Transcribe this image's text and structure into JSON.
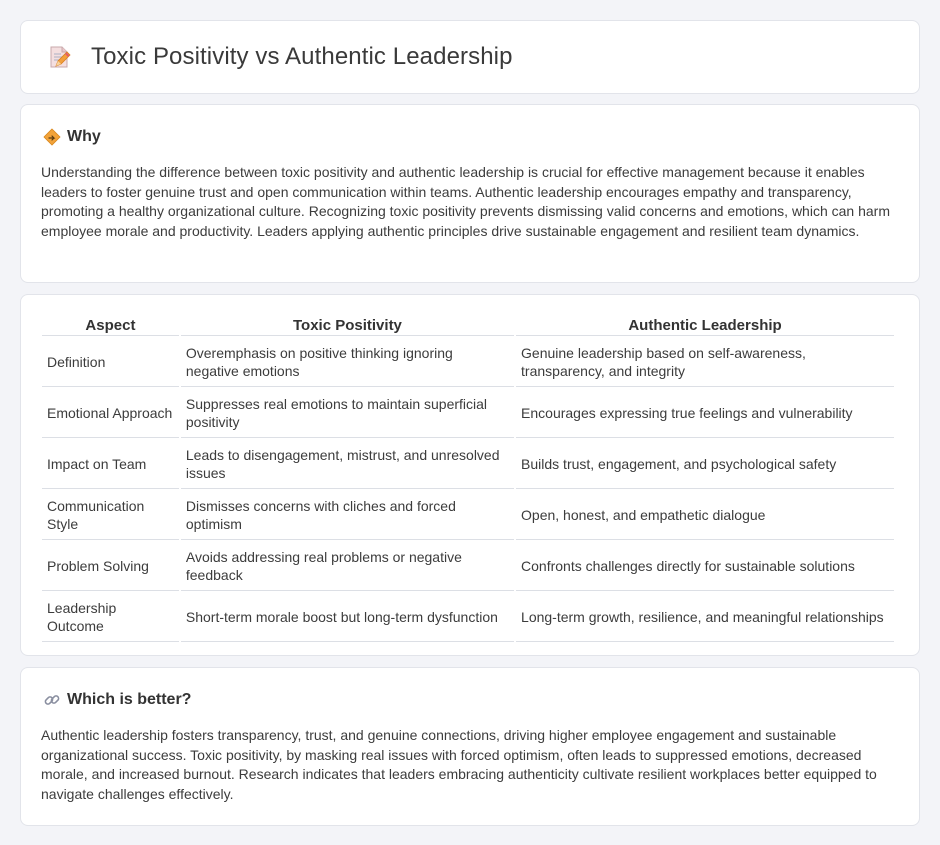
{
  "header": {
    "title": "Toxic Positivity vs Authentic Leadership",
    "icon": "document-pencil-icon"
  },
  "why": {
    "icon": "diamond-sign-icon",
    "title": "Why",
    "text": "Understanding the difference between toxic positivity and authentic leadership is crucial for effective management because it enables leaders to foster genuine trust and open communication within teams. Authentic leadership encourages empathy and transparency, promoting a healthy organizational culture. Recognizing toxic positivity prevents dismissing valid concerns and emotions, which can harm employee morale and productivity. Leaders applying authentic principles drive sustainable engagement and resilient team dynamics."
  },
  "comparison": {
    "headers": [
      "Aspect",
      "Toxic Positivity",
      "Authentic Leadership"
    ],
    "rows": [
      [
        "Definition",
        "Overemphasis on positive thinking ignoring negative emotions",
        "Genuine leadership based on self-awareness, transparency, and integrity"
      ],
      [
        "Emotional Approach",
        "Suppresses real emotions to maintain superficial positivity",
        "Encourages expressing true feelings and vulnerability"
      ],
      [
        "Impact on Team",
        "Leads to disengagement, mistrust, and unresolved issues",
        "Builds trust, engagement, and psychological safety"
      ],
      [
        "Communication Style",
        "Dismisses concerns with cliches and forced optimism",
        "Open, honest, and empathetic dialogue"
      ],
      [
        "Problem Solving",
        "Avoids addressing real problems or negative feedback",
        "Confronts challenges directly for sustainable solutions"
      ],
      [
        "Leadership Outcome",
        "Short-term morale boost but long-term dysfunction",
        "Long-term growth, resilience, and meaningful relationships"
      ]
    ]
  },
  "better": {
    "icon": "link-icon",
    "title": "Which is better?",
    "text": "Authentic leadership fosters transparency, trust, and genuine connections, driving higher employee engagement and sustainable organizational success. Toxic positivity, by masking real issues with forced optimism, often leads to suppressed emotions, decreased morale, and increased burnout. Research indicates that leaders embracing authenticity cultivate resilient workplaces better equipped to navigate challenges effectively."
  },
  "colors": {
    "background": "#f3f4f8",
    "card": "#ffffff",
    "border": "#e2e4ea",
    "accent_orange": "#f0a030"
  }
}
